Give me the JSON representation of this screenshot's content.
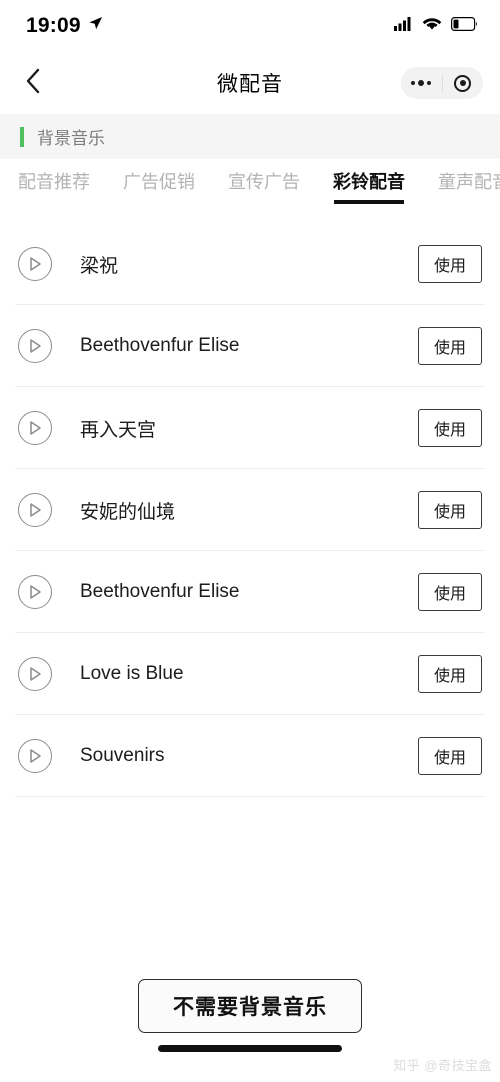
{
  "status_bar": {
    "time": "19:09",
    "location_icon": "location-arrow-icon",
    "signal_icon": "cellular-signal-icon",
    "wifi_icon": "wifi-icon",
    "battery_icon": "battery-low-icon",
    "signal_bars": 4,
    "battery_level_pct": 25
  },
  "nav_bar": {
    "back_icon": "chevron-left-icon",
    "title": "微配音",
    "capsule": {
      "more_icon": "more-dots-icon",
      "target_icon": "target-circle-icon"
    }
  },
  "section": {
    "label": "背景音乐",
    "accent_color": "#4fbf5f",
    "band_color": "#f5f5f5"
  },
  "tabs": [
    {
      "label": "配音推荐",
      "active": false
    },
    {
      "label": "广告促销",
      "active": false
    },
    {
      "label": "宣传广告",
      "active": false
    },
    {
      "label": "彩铃配音",
      "active": true
    },
    {
      "label": "童声配音",
      "active": false
    }
  ],
  "list": {
    "use_label": "使用",
    "play_icon": "play-circle-icon",
    "tracks": [
      {
        "name": "梁祝"
      },
      {
        "name": "Beethovenfur Elise"
      },
      {
        "name": "再入天宫"
      },
      {
        "name": "安妮的仙境"
      },
      {
        "name": "Beethovenfur Elise"
      },
      {
        "name": "Love is Blue"
      },
      {
        "name": "Souvenirs"
      }
    ]
  },
  "footer": {
    "no_bgm_label": "不需要背景音乐",
    "home_indicator": "home-indicator",
    "watermark": "知乎 @奇技宝盒"
  }
}
